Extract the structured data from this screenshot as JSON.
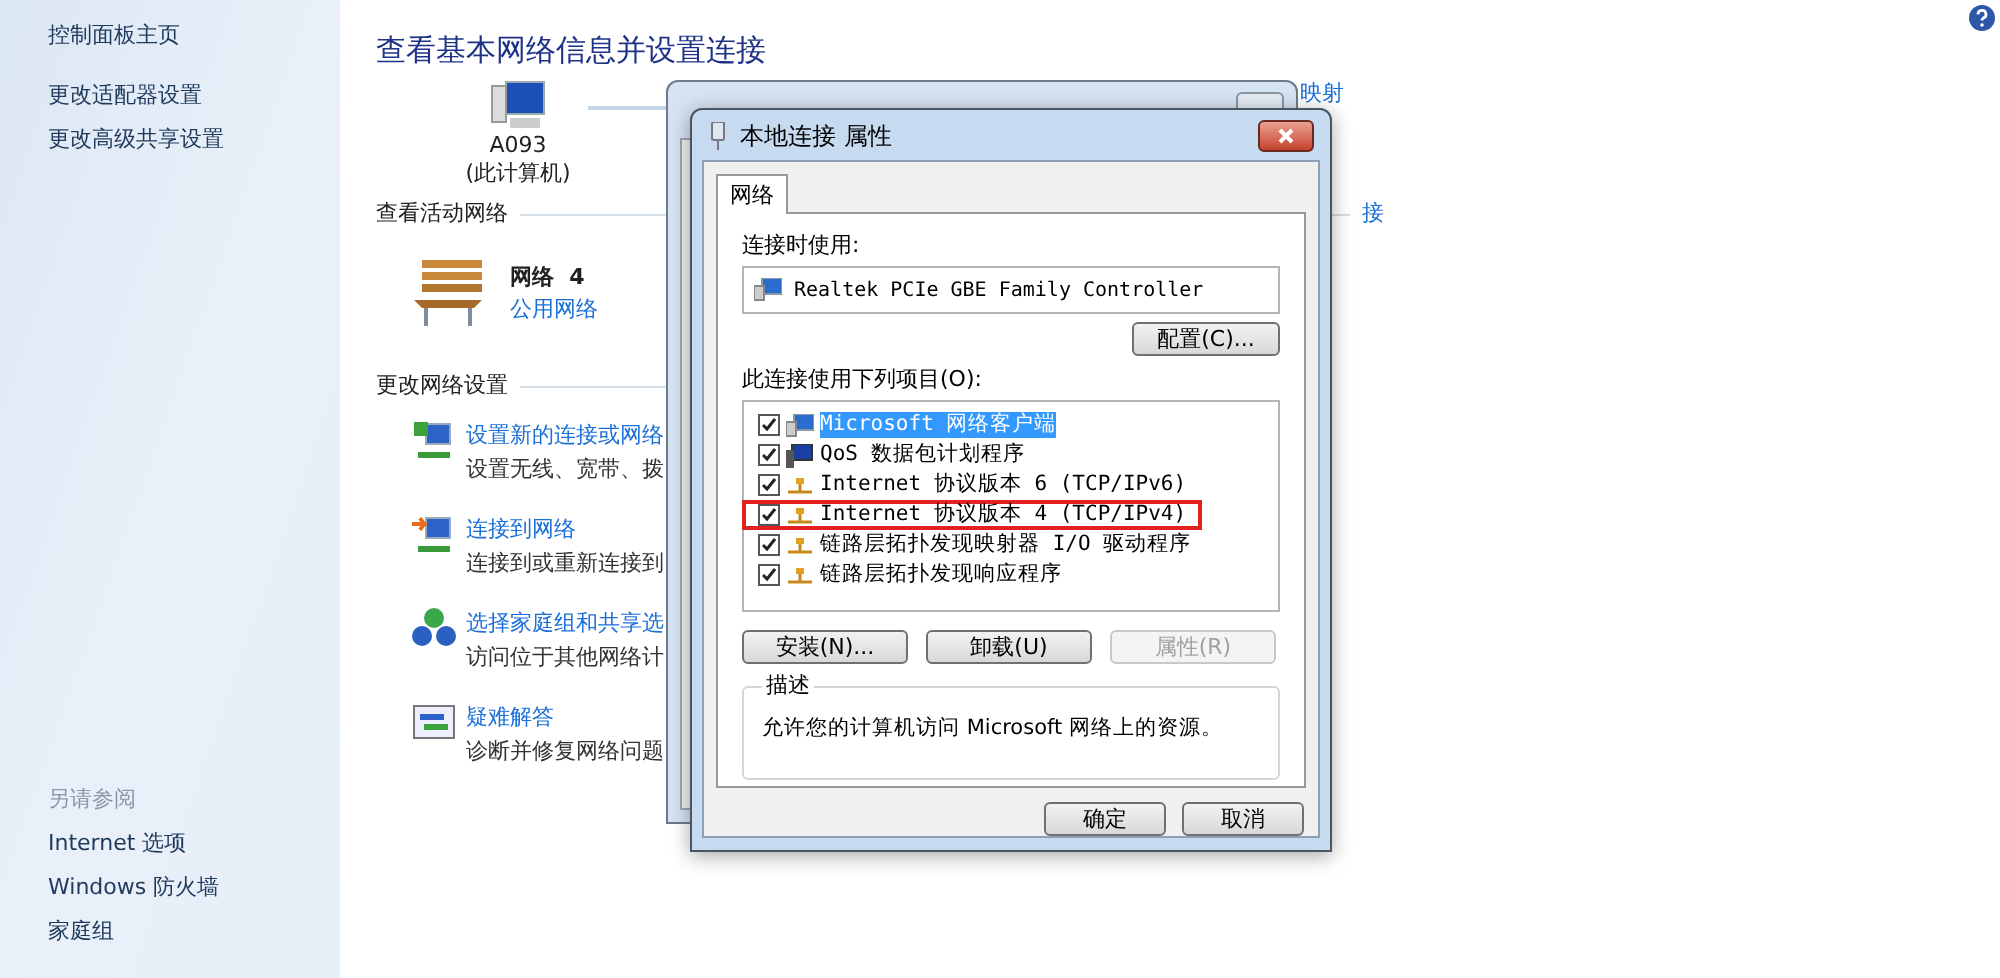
{
  "sidebar": {
    "items": [
      {
        "label": "控制面板主页"
      },
      {
        "label": "更改适配器设置"
      },
      {
        "label": "更改高级共享设置"
      }
    ],
    "see_also": {
      "heading": "另请参阅",
      "items": [
        {
          "label": "Internet 选项"
        },
        {
          "label": "Windows 防火墙"
        },
        {
          "label": "家庭组"
        }
      ]
    }
  },
  "main": {
    "title": "查看基本网络信息并设置连接",
    "computer": {
      "name": "A093",
      "note": "(此计算机)"
    },
    "map_link_fragment": "映射",
    "active_networks": {
      "heading": "查看活动网络",
      "network": {
        "name": "网络  4",
        "type": "公用网络"
      },
      "connect_link_fragment": "接"
    },
    "settings": {
      "heading": "更改网络设置",
      "tasks": [
        {
          "kind": "new-connection",
          "title": "设置新的连接或网络",
          "description": "设置无线、宽带、拨"
        },
        {
          "kind": "connect",
          "title": "连接到网络",
          "description": "连接到或重新连接到"
        },
        {
          "kind": "homegroup",
          "title": "选择家庭组和共享选",
          "description": "访问位于其他网络计"
        },
        {
          "kind": "troubleshoot",
          "title": "疑难解答",
          "description": "诊断并修复网络问题"
        }
      ]
    }
  },
  "dialog": {
    "title": "本地连接 属性",
    "tabs": [
      {
        "label": "网络",
        "selected": true
      }
    ],
    "connect_using_label": "连接时使用:",
    "adapter": "Realtek PCIe GBE Family Controller",
    "configure_button": "配置(C)...",
    "items_label": "此连接使用下列项目(O):",
    "items": [
      {
        "kind": "client",
        "label": "Microsoft 网络客户端",
        "checked": true,
        "selected": true,
        "highlighted": false
      },
      {
        "kind": "service",
        "label": "QoS 数据包计划程序",
        "checked": true,
        "selected": false,
        "highlighted": false
      },
      {
        "kind": "protocol",
        "label": "Internet 协议版本 6 (TCP/IPv6)",
        "checked": true,
        "selected": false,
        "highlighted": false
      },
      {
        "kind": "protocol",
        "label": "Internet 协议版本 4 (TCP/IPv4)",
        "checked": true,
        "selected": false,
        "highlighted": true
      },
      {
        "kind": "protocol",
        "label": "链路层拓扑发现映射器 I/O 驱动程序",
        "checked": true,
        "selected": false,
        "highlighted": false
      },
      {
        "kind": "protocol",
        "label": "链路层拓扑发现响应程序",
        "checked": true,
        "selected": false,
        "highlighted": false
      }
    ],
    "buttons": [
      {
        "label": "安装(N)...",
        "disabled": false
      },
      {
        "label": "卸载(U)",
        "disabled": false
      },
      {
        "label": "属性(R)",
        "disabled": true
      }
    ],
    "description": {
      "heading": "描述",
      "text": "允许您的计算机访问 Microsoft 网络上的资源。"
    },
    "footer_buttons": [
      {
        "label": "确定"
      },
      {
        "label": "取消"
      }
    ]
  }
}
